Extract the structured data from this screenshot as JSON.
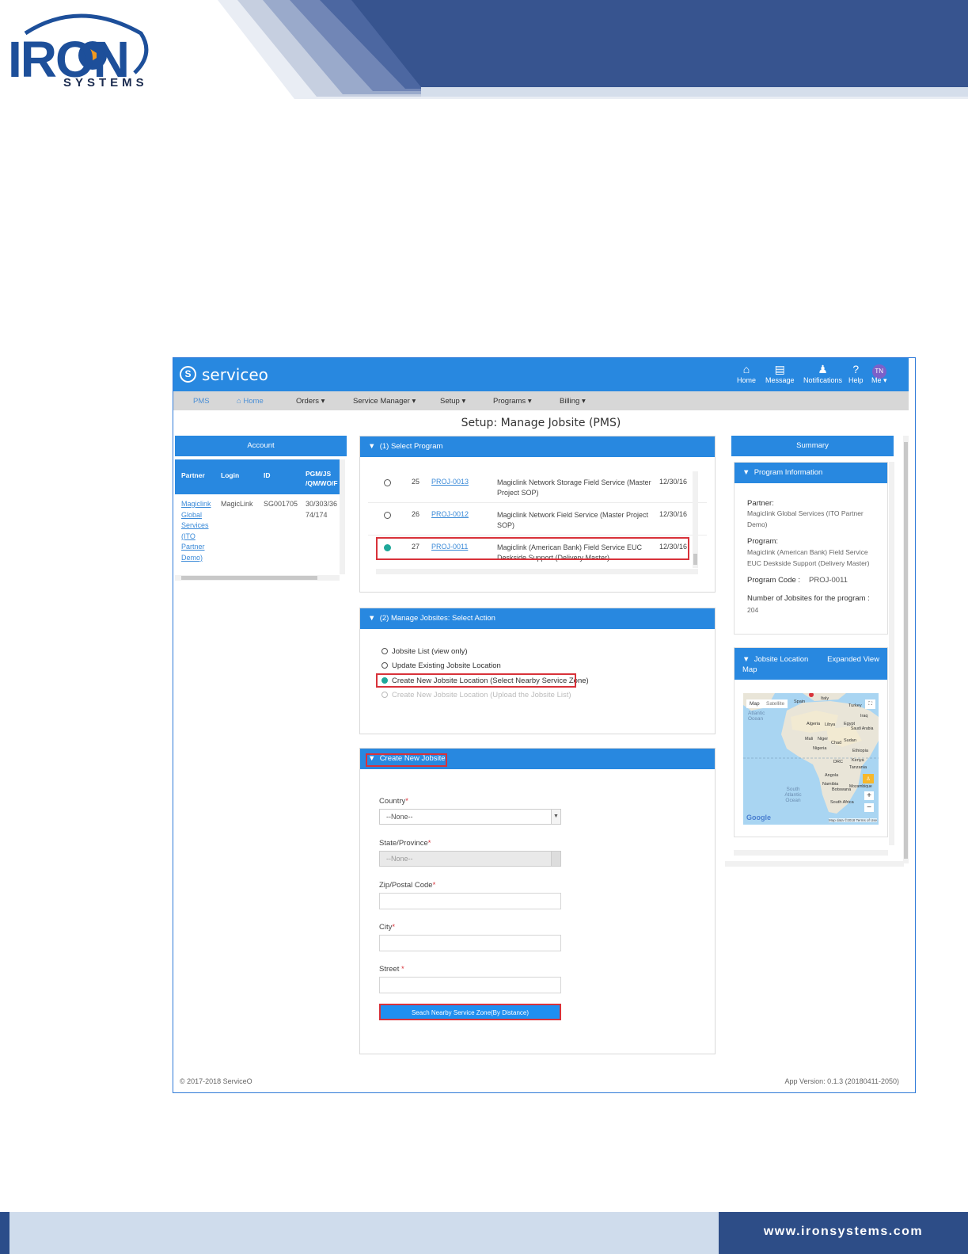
{
  "letterhead": {
    "logo_word": "IRON",
    "logo_sub": "SYSTEMS",
    "brand_colors": {
      "navy": "#2d4d87",
      "light_band": "#cfdcec",
      "orange_play": "#f29a1f"
    },
    "footer_url": "www.ironsystems.com"
  },
  "app": {
    "brand": "serviceo",
    "brand_icon": "S",
    "topnav": [
      {
        "label": "Home",
        "icon": "home-icon"
      },
      {
        "label": "Message",
        "icon": "message-icon"
      },
      {
        "label": "Notifications",
        "icon": "bell-icon"
      },
      {
        "label": "Help",
        "icon": "help-icon"
      },
      {
        "label": "Me",
        "avatar": "TN"
      }
    ],
    "menu": [
      "PMS",
      "Home",
      "Orders",
      "Service Manager",
      "Setup",
      "Programs",
      "Billing"
    ],
    "page_title": "Setup: Manage Jobsite (PMS)",
    "account": {
      "title": "Account",
      "headers": [
        "Partner",
        "Login",
        "ID",
        "PGM/JS /QM/WO/F"
      ],
      "row": {
        "partner": "Magiclink Global Services (ITO Partner Demo)",
        "partner_lines": [
          "Magiclink",
          "Global",
          "Services",
          "(ITO",
          "Partner",
          "Demo)"
        ],
        "login": "MagicLink",
        "id": "SG001705",
        "counts": [
          "30/303/36",
          "74/174"
        ]
      }
    },
    "select_program": {
      "title": "(1) Select Program",
      "rows": [
        {
          "num": "25",
          "code": "PROJ-0013",
          "name": "Magiclink Network Storage Field Service (Master Project SOP)",
          "date": "12/30/16",
          "selected": false
        },
        {
          "num": "26",
          "code": "PROJ-0012",
          "name": "Magiclink Network Field Service (Master Project SOP)",
          "date": "12/30/16",
          "selected": false
        },
        {
          "num": "27",
          "code": "PROJ-0011",
          "name": "Magiclink (American Bank) Field Service EUC Deskside Support (Delivery Master)",
          "date": "12/30/16",
          "selected": true
        }
      ]
    },
    "manage_jobsites": {
      "title": "(2) Manage Jobsites: Select Action",
      "options": [
        {
          "label": "Jobsite List (view only)",
          "state": "off"
        },
        {
          "label": "Update Existing Jobsite Location",
          "state": "off"
        },
        {
          "label": "Create New Jobsite Location (Select Nearby Service Zone)",
          "state": "on"
        },
        {
          "label": "Create New Jobsite Location (Upload the Jobsite List)",
          "state": "disabled"
        }
      ]
    },
    "create_jobsite": {
      "title": "Create New Jobsite",
      "country_label": "Country",
      "country_value": "--None--",
      "state_label": "State/Province",
      "state_value": "--None--",
      "zip_label": "Zip/Postal Code",
      "city_label": "City",
      "street_label": "Street ",
      "search_button": "Seach Nearby Service Zone(By Distance)"
    },
    "summary": {
      "title": "Summary",
      "program_info_title": "Program Information",
      "partner_label": "Partner:",
      "partner_value": "Magiclink Global Services (ITO Partner Demo)",
      "program_label": "Program:",
      "program_value": "Magiclink (American Bank) Field Service EUC Deskside Support (Delivery Master)",
      "program_code_label": "Program Code :",
      "program_code_value": "PROJ-0011",
      "jobsites_label": "Number of Jobsites for the program :",
      "jobsites_value": "204",
      "map_title": "Jobsite Location Map",
      "map_expand": "Expanded View",
      "map_tab_map": "Map",
      "map_tab_satellite": "Satellite",
      "map_google": "Google",
      "map_attrib": "Map data ©2018   Terms of Use",
      "map_labels": [
        "Atlantic Ocean",
        "Algeria",
        "Libya",
        "Egypt",
        "Mali",
        "Niger",
        "Chad",
        "Sudan",
        "Nigeria",
        "Ethiopia",
        "DRC",
        "Kenya",
        "Tanzania",
        "Angola",
        "Namibia",
        "Botswana",
        "Mozambique",
        "South Africa",
        "South Atlantic Ocean",
        "Spain",
        "Italy",
        "Turkey",
        "Iraq",
        "Saudi Arabia"
      ]
    },
    "footer_left": "© 2017-2018 ServiceO",
    "footer_right": "App Version: 0.1.3 (20180411-2050)",
    "accent_color": "#2888e0"
  }
}
